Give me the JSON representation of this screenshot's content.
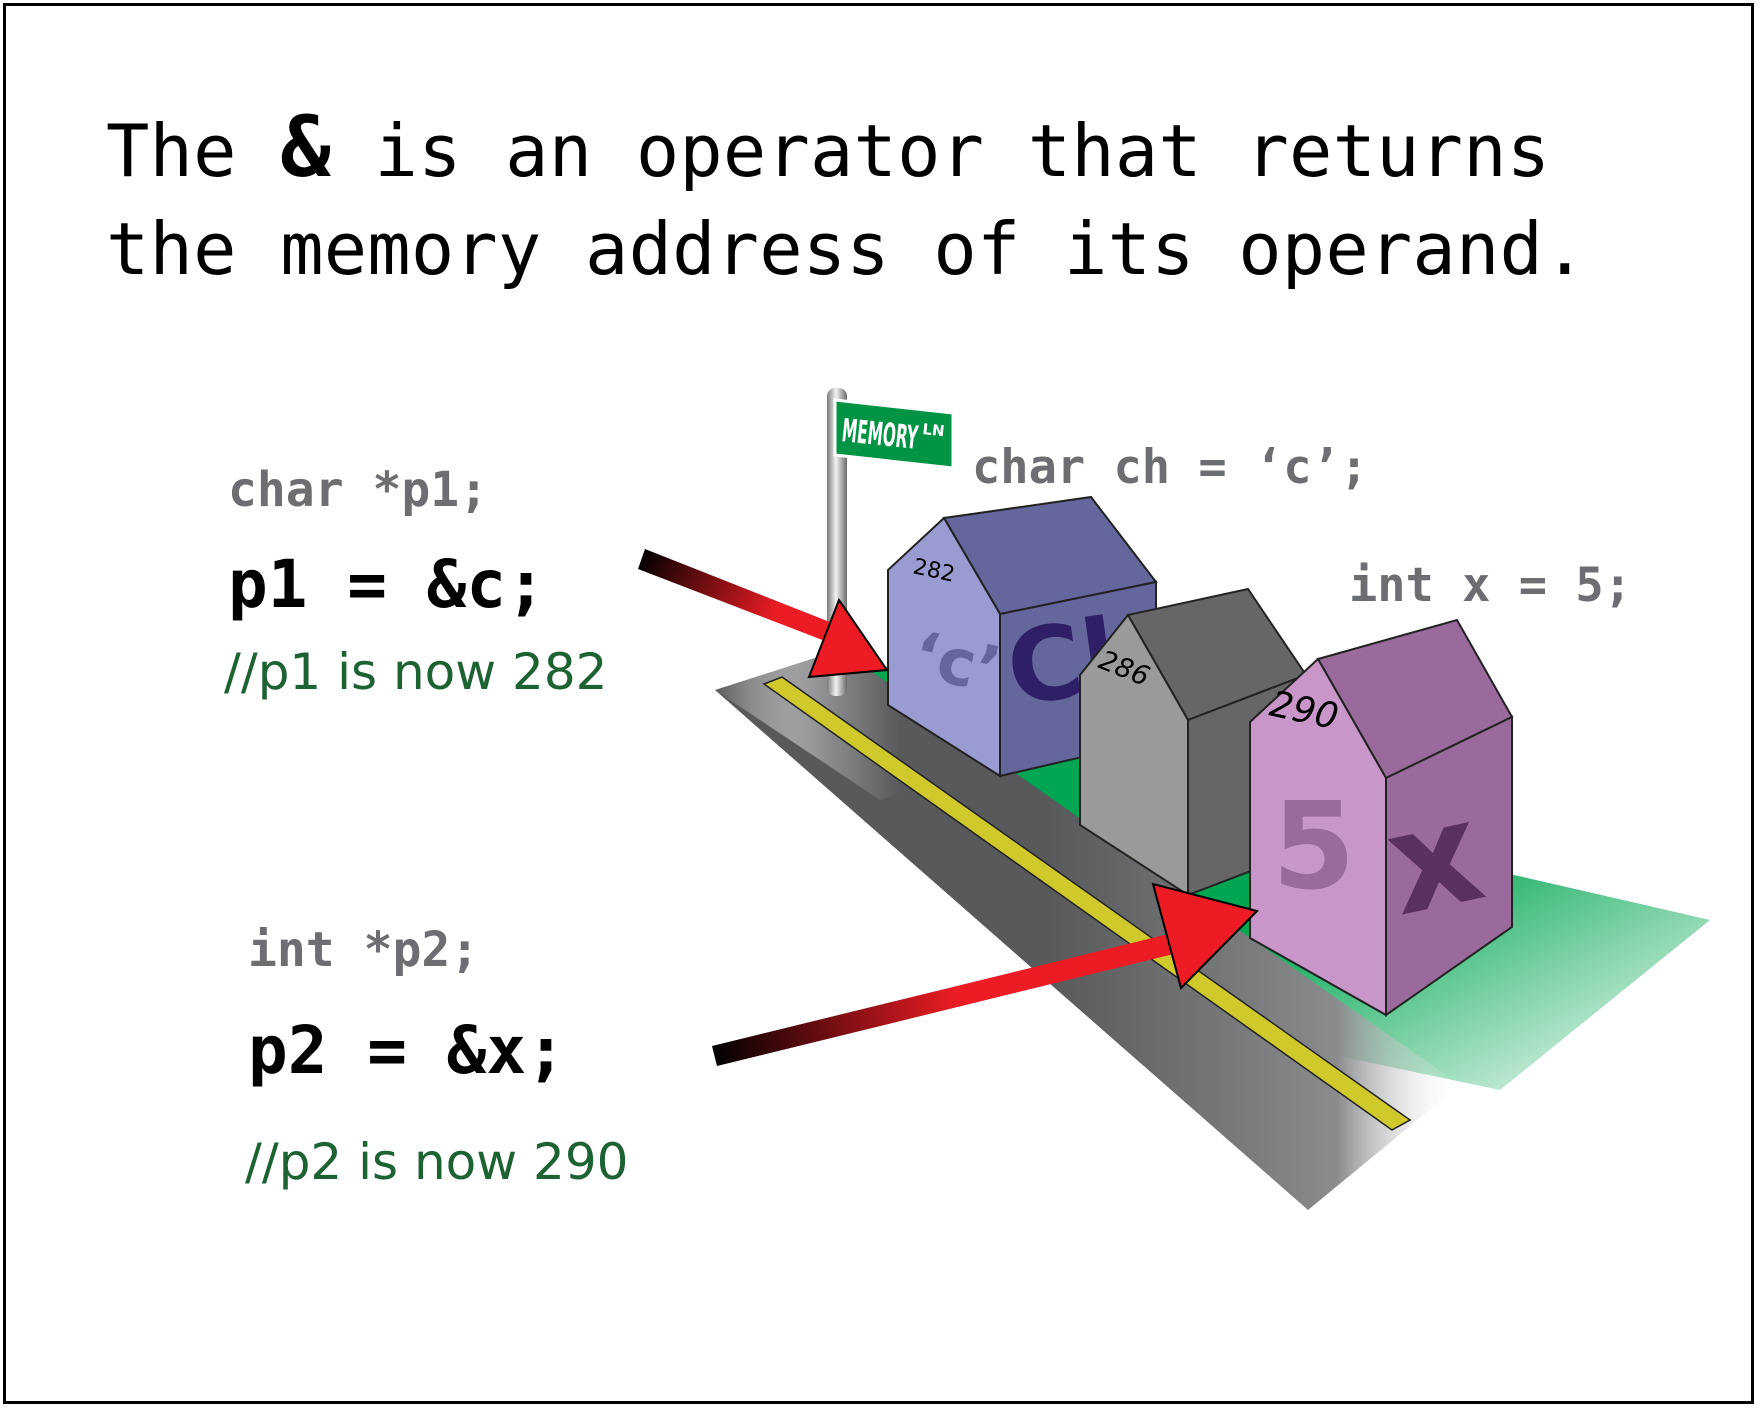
{
  "headline": {
    "line1_before": "The ",
    "line1_operator": "&",
    "line1_after": " is an operator that returns",
    "line2": "the memory address of its operand."
  },
  "pointer1": {
    "declaration": "char *p1;",
    "assignment": "p1 = &c;",
    "comment": "//p1 is now 282"
  },
  "pointer2": {
    "declaration": "int *p2;",
    "assignment": "p2 = &x;",
    "comment": "//p2 is now 290"
  },
  "street_sign": {
    "name": "MEMORY",
    "suffix": "LN"
  },
  "houses": [
    {
      "declaration": "char ch = ‘c’;",
      "address": "282",
      "value": "‘c’",
      "name": "Ch",
      "color": "#9a9bd0",
      "side_color": "#64669c"
    },
    {
      "declaration": "",
      "address": "286",
      "value": "",
      "name": "",
      "color": "#9a9a9a",
      "side_color": "#666666"
    },
    {
      "declaration": "int x = 5;",
      "address": "290",
      "value": "5",
      "name": "x",
      "color": "#c896c8",
      "side_color": "#9b6a9c"
    }
  ],
  "colors": {
    "arrow": "#ed1c24",
    "lawn": "#00a651",
    "road": "#58595b",
    "road_stripe": "#cfc92c",
    "comment_text": "#1c6233",
    "declaration_text": "#6d6e71",
    "sign": "#009444"
  }
}
